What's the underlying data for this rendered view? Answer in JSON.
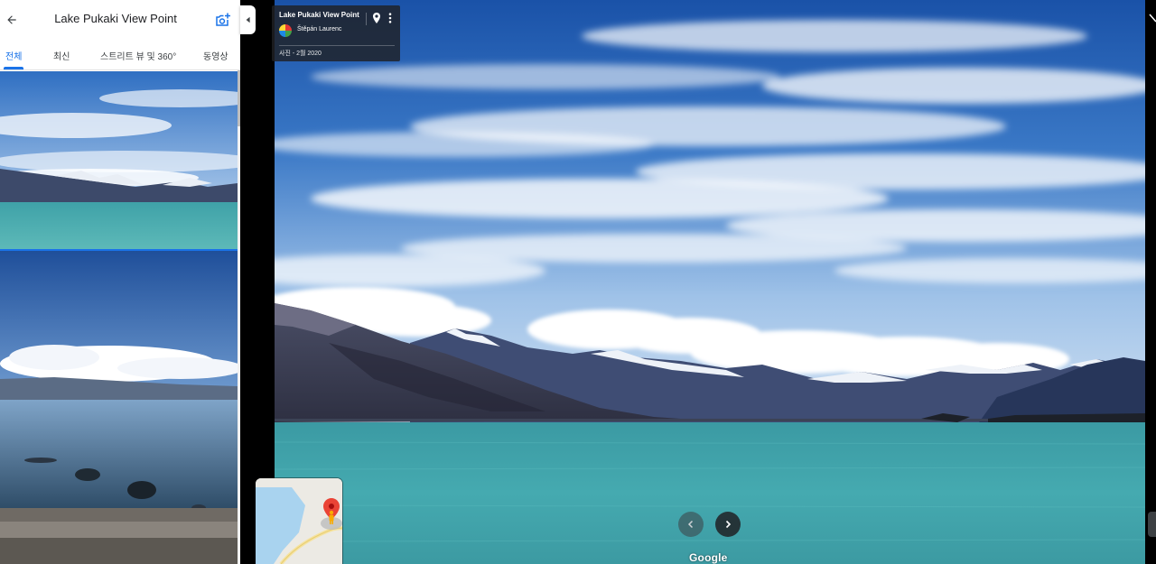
{
  "panel": {
    "title": "Lake Pukaki View Point",
    "back_icon": "arrow-left-icon",
    "add_photo_icon": "add-photo-camera-icon",
    "tabs": [
      {
        "label": "전체",
        "active": true
      },
      {
        "label": "최신",
        "active": false
      },
      {
        "label": "스트리트 뷰 및 360°",
        "active": false
      },
      {
        "label": "동영상",
        "active": false
      }
    ],
    "accent_color": "#1a73e8"
  },
  "info_card": {
    "title": "Lake Pukaki View Point",
    "author": "Štěpán Laurenc",
    "date": "사진 - 2월 2020",
    "pin_icon": "location-pin-icon",
    "more_icon": "more-vert-icon"
  },
  "viewer": {
    "prev_icon": "chevron-left-icon",
    "next_icon": "chevron-right-icon",
    "logo": "Google",
    "collapse_icon": "chevron-left-icon",
    "minimap_pin_icon": "map-pin-icon",
    "pegman_icon": "pegman-icon"
  }
}
